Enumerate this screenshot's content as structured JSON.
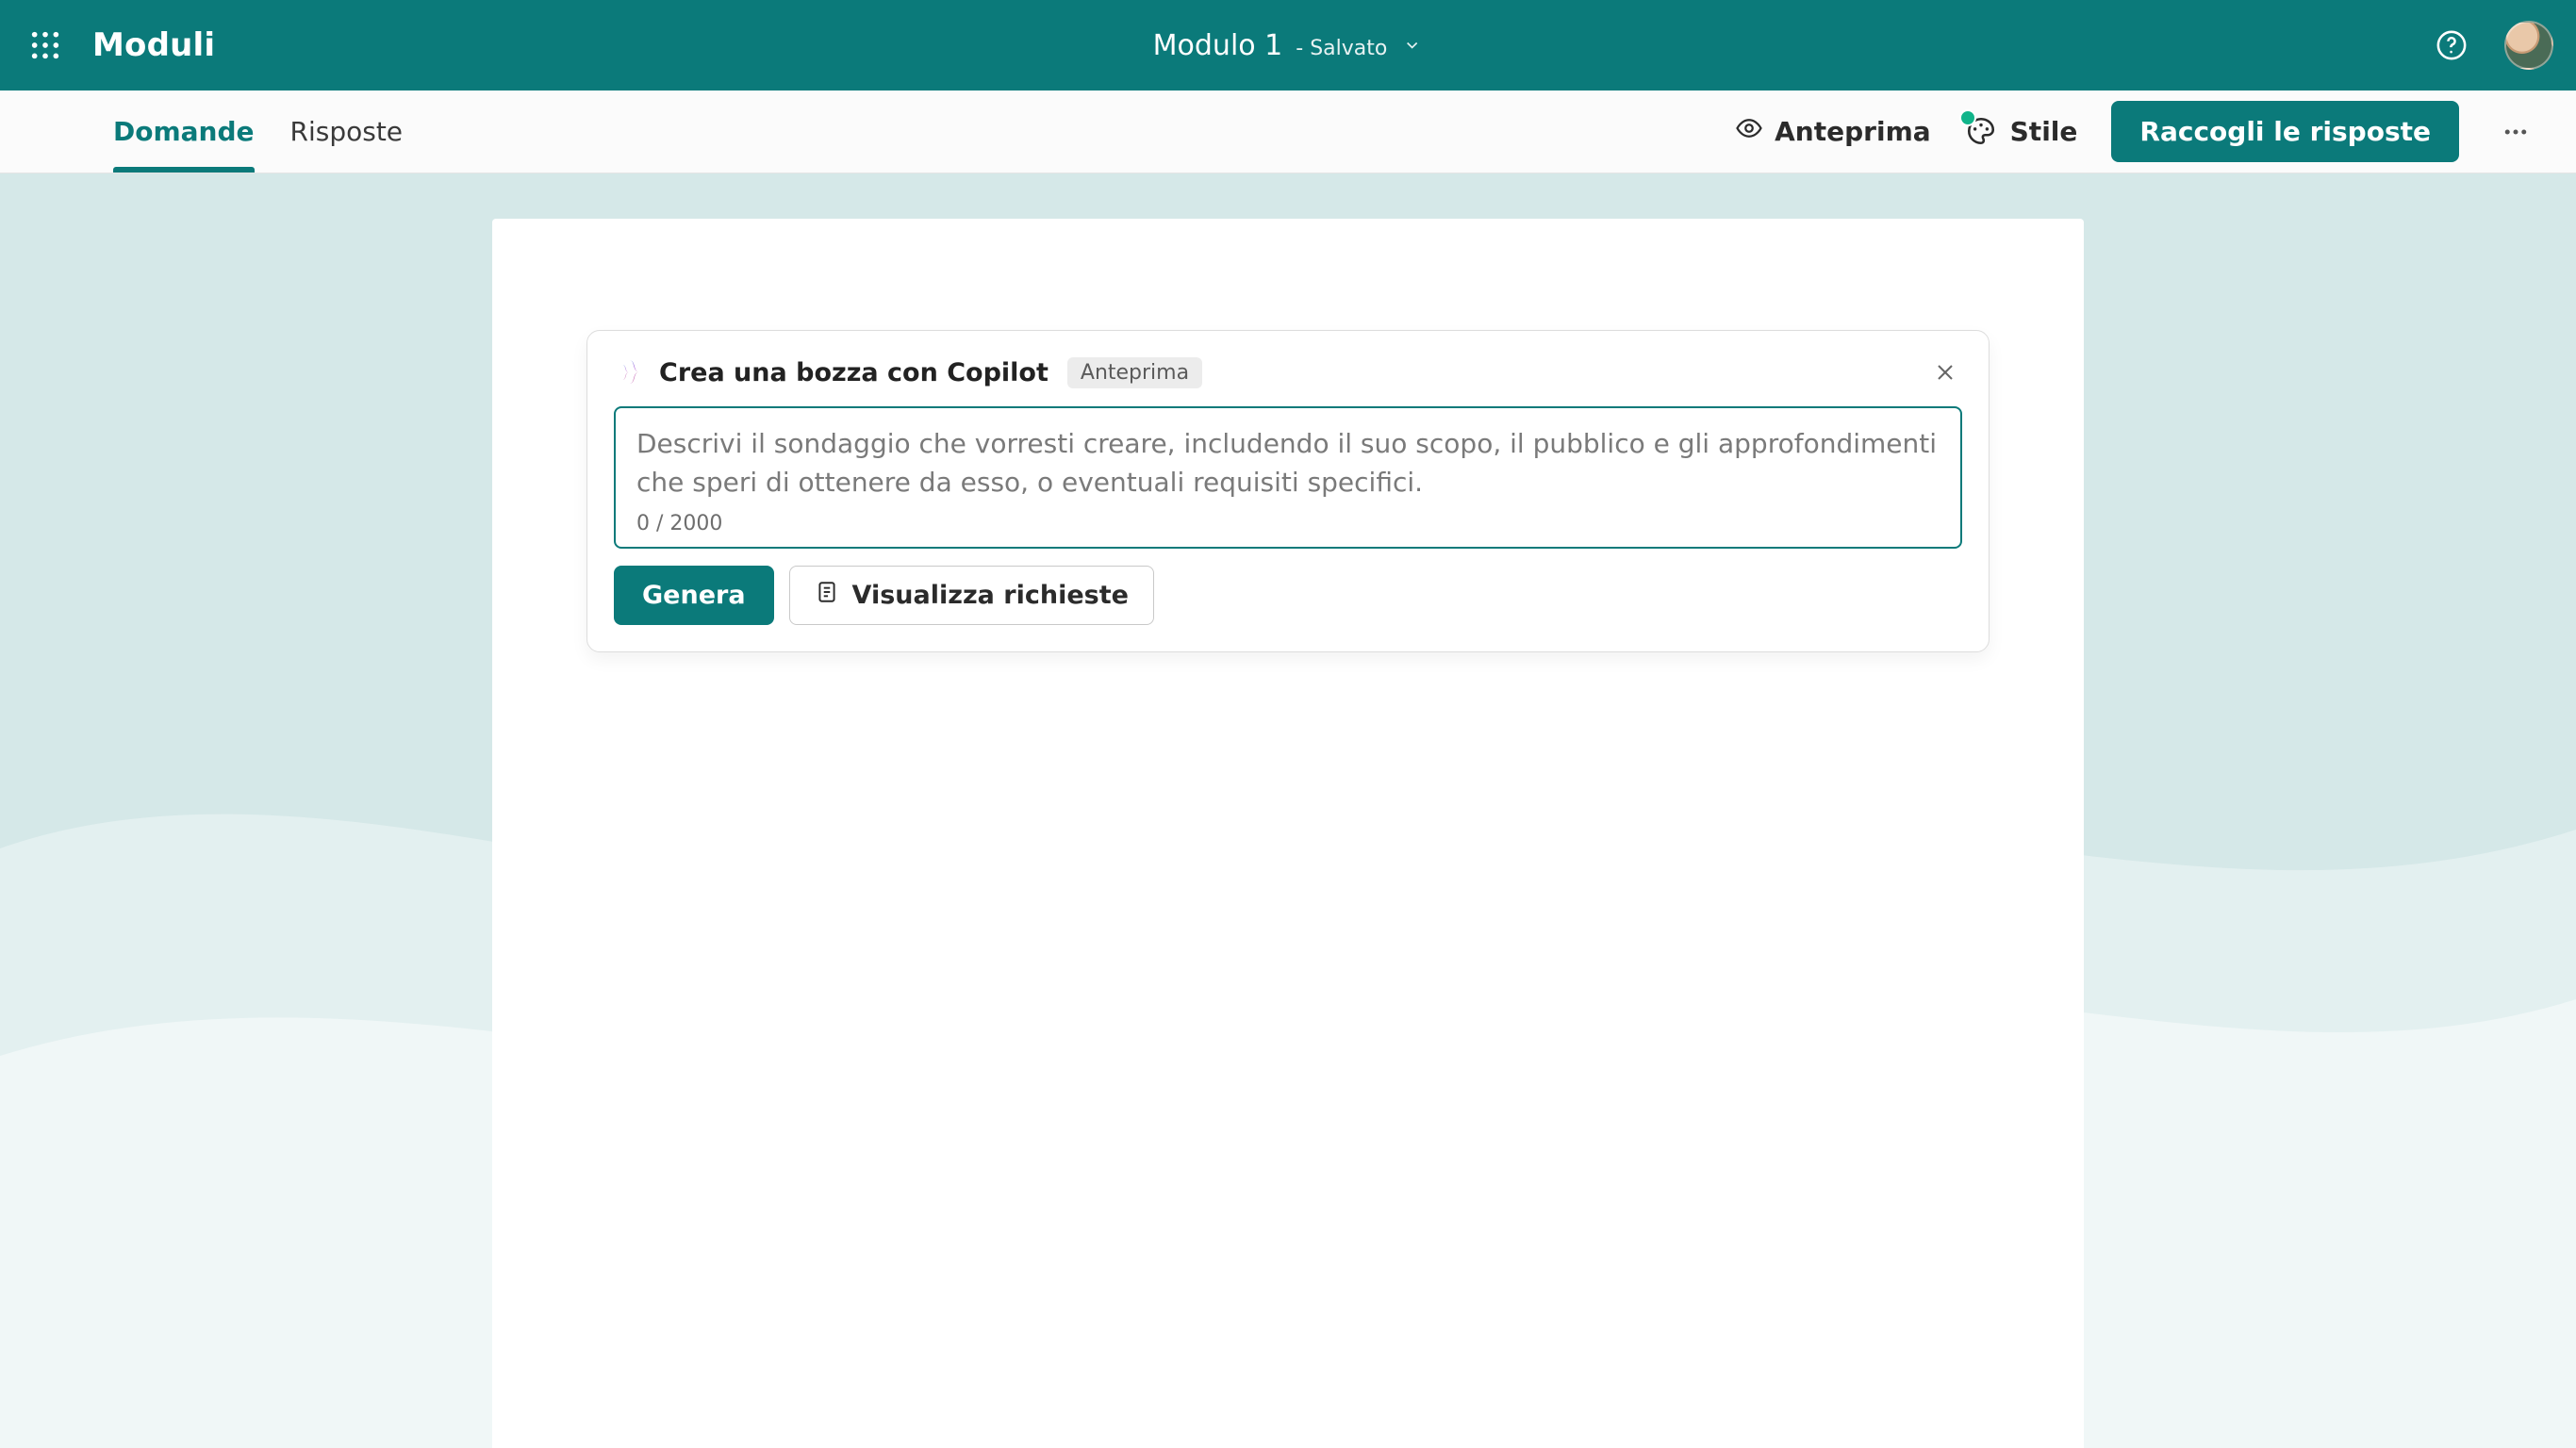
{
  "header": {
    "app_name": "Moduli",
    "form_title": "Modulo 1",
    "status_prefix": "- ",
    "status": "Salvato"
  },
  "subbar": {
    "tabs": {
      "questions": "Domande",
      "responses": "Risposte"
    },
    "preview": "Anteprima",
    "style": "Stile",
    "collect": "Raccogli le risposte"
  },
  "copilot": {
    "title": "Crea una bozza con Copilot",
    "badge": "Anteprima",
    "placeholder": "Descrivi il sondaggio che vorresti creare, includendo il suo scopo, il pubblico e gli approfondimenti che speri di ottenere da esso, o eventuali requisiti specifici.",
    "counter": "0 / 2000",
    "generate": "Genera",
    "view_prompts": "Visualizza richieste"
  },
  "colors": {
    "brand": "#0b7a7a",
    "accent": "#11b48a"
  }
}
